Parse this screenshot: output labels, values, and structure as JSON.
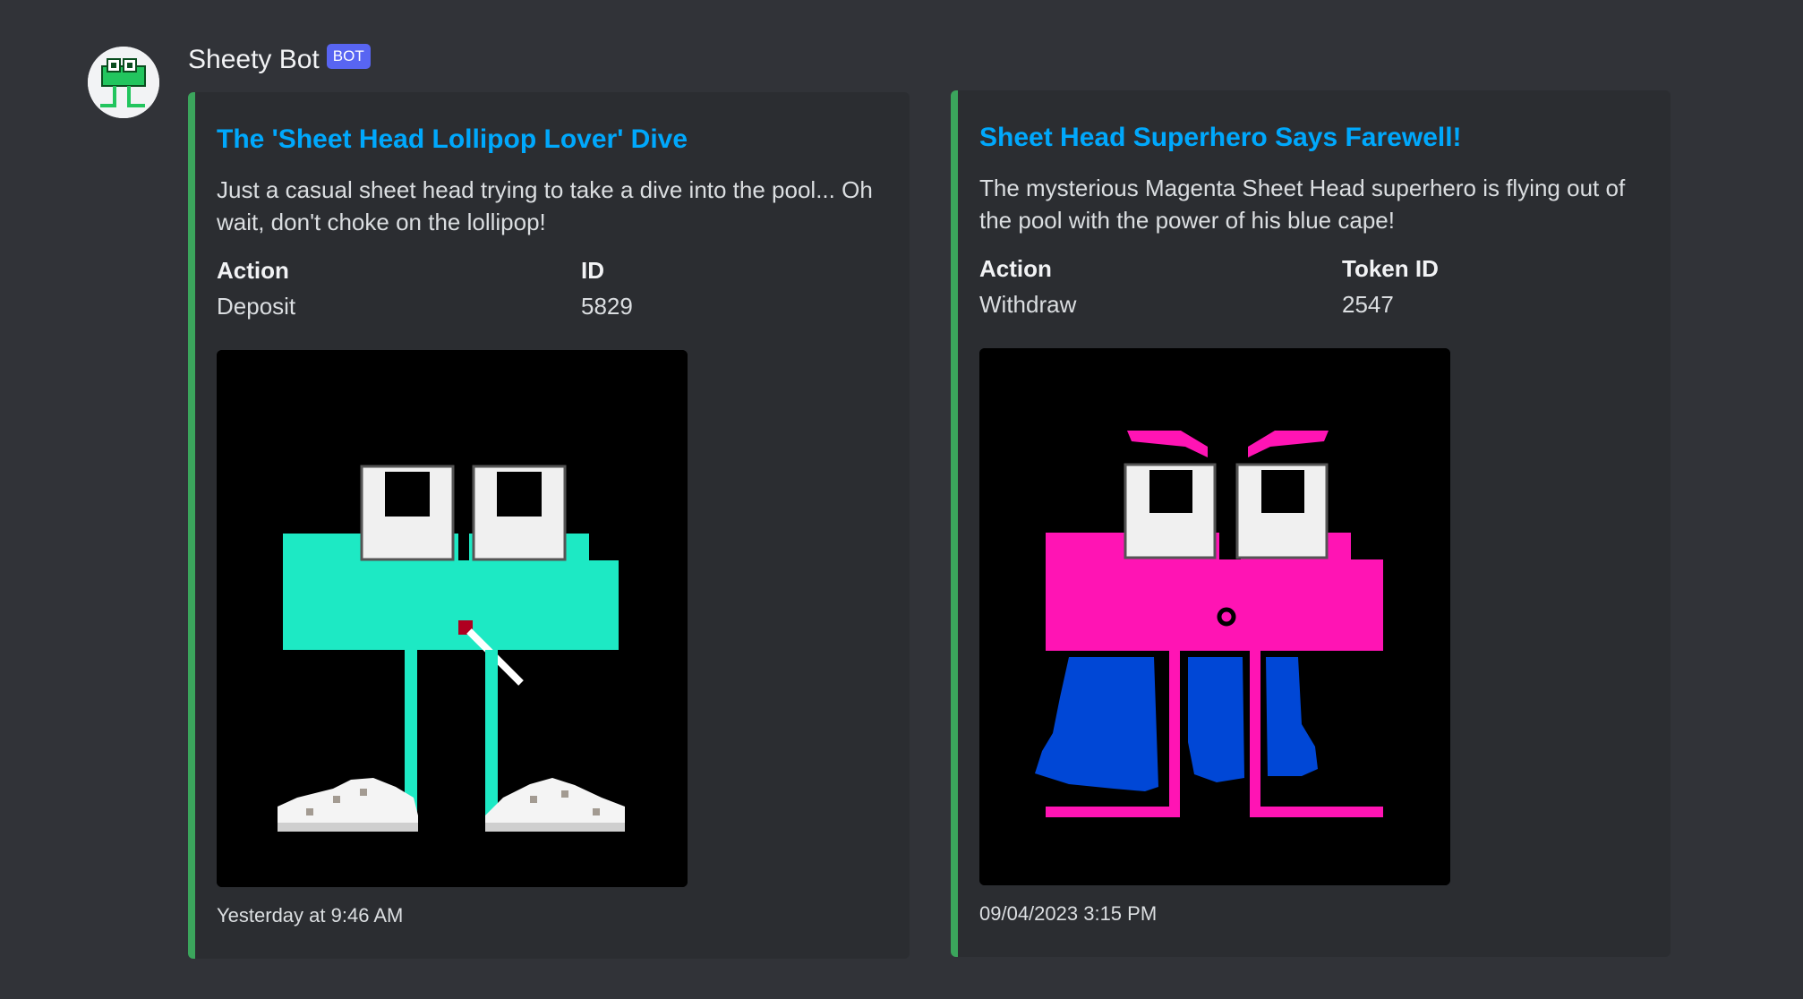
{
  "message": {
    "author": "Sheety Bot",
    "tag": "BOT"
  },
  "embeds": [
    {
      "title": "The 'Sheet Head Lollipop Lover' Dive",
      "description": "Just a casual sheet head trying to take a dive into the pool... Oh wait, don't choke on the lollipop!",
      "fields": [
        {
          "name": "Action",
          "value": "Deposit"
        },
        {
          "name": "ID",
          "value": "5829"
        }
      ],
      "image": "sheet-head-cyan",
      "footer": "Yesterday at 9:46 AM",
      "accent_color": "#3ba55c"
    },
    {
      "title": "Sheet Head Superhero Says Farewell!",
      "description": "The mysterious Magenta Sheet Head superhero is flying out of the pool with the power of his blue cape!",
      "fields": [
        {
          "name": "Action",
          "value": "Withdraw"
        },
        {
          "name": "Token ID",
          "value": "2547"
        }
      ],
      "image": "sheet-head-magenta",
      "footer": "09/04/2023 3:15 PM",
      "accent_color": "#3ba55c"
    }
  ],
  "colors": {
    "background": "#313338",
    "embed_background": "#2b2d31",
    "link": "#00a8fc",
    "bot_tag": "#5865f2"
  }
}
